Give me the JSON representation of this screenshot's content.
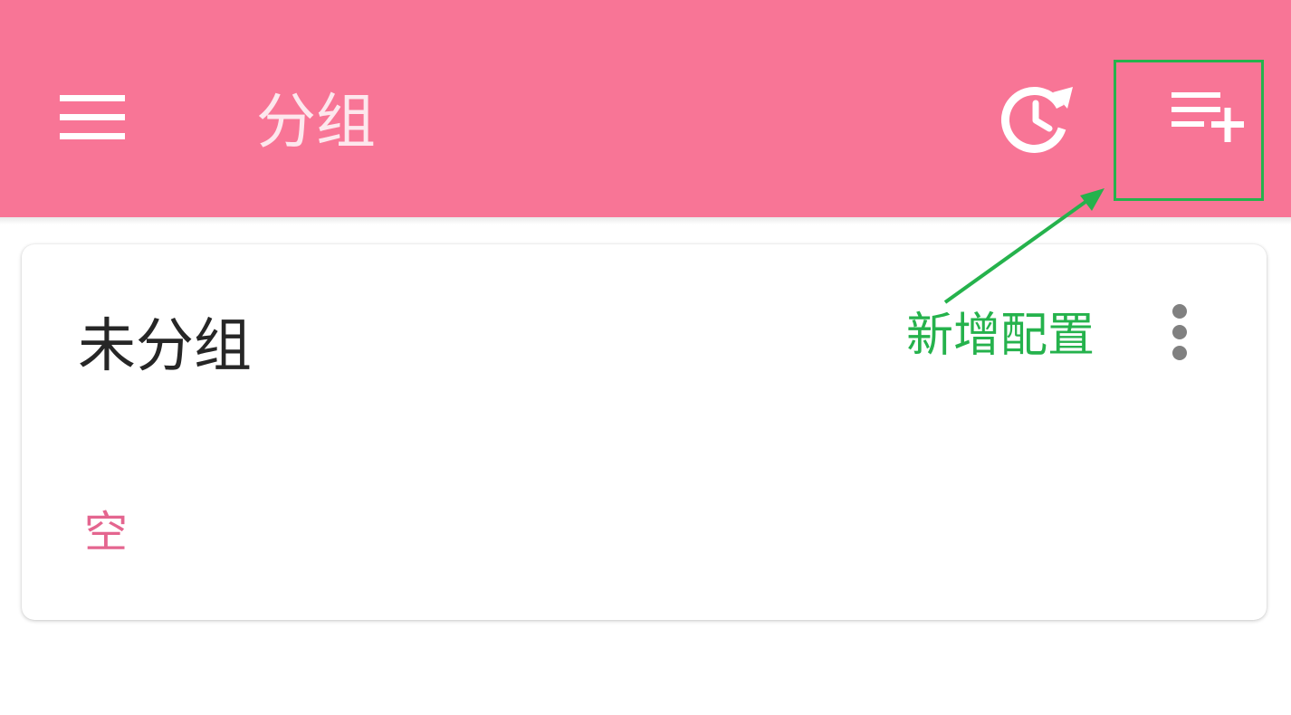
{
  "toolbar": {
    "title": "分组",
    "background_color": "#f87596",
    "menu_icon": "hamburger-menu-icon",
    "history_icon": "history-clock-icon",
    "add_icon": "playlist-add-icon"
  },
  "annotation": {
    "label": "新增配置",
    "color": "#25b24c"
  },
  "group_card": {
    "title": "未分组",
    "status": "空",
    "status_color": "#e4658f",
    "menu_icon": "more-vertical-icon"
  }
}
